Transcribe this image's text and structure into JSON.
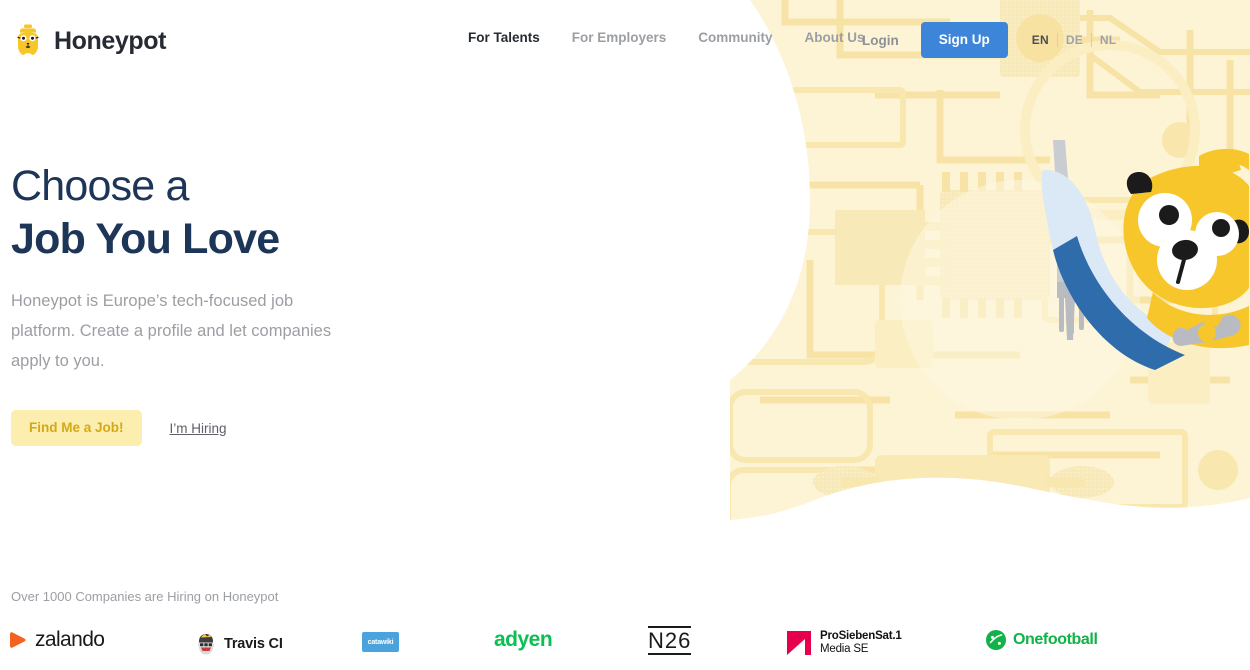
{
  "brand": {
    "name": "Honeypot",
    "logo_icon": "honeypot-bear-icon"
  },
  "nav": {
    "items": [
      {
        "label": "For Talents",
        "active": true
      },
      {
        "label": "For Employers",
        "active": false
      },
      {
        "label": "Community",
        "active": false
      },
      {
        "label": "About Us",
        "active": false
      }
    ],
    "login_label": "Login",
    "signup_label": "Sign Up",
    "languages": [
      {
        "code": "EN",
        "active": true
      },
      {
        "code": "DE",
        "active": false
      },
      {
        "code": "NL",
        "active": false
      }
    ]
  },
  "hero": {
    "headline_line1": "Choose a",
    "headline_line2": "Job You Love",
    "subcopy": "Honeypot is Europe’s tech-focused job platform. Create a profile and let companies apply to you.",
    "cta_primary": "Find Me a Job!",
    "cta_secondary": "I’m Hiring",
    "illustration_icon": "bear-mascot-with-wrench-illustration",
    "background_icon": "circuit-board-pattern"
  },
  "companies": {
    "label": "Over 1000 Companies are Hiring on Honeypot",
    "logos": [
      {
        "name": "zalando",
        "text": "zalando"
      },
      {
        "name": "travis-ci",
        "text": "Travis CI"
      },
      {
        "name": "catawiki",
        "text": "catawiki"
      },
      {
        "name": "adyen",
        "text": "adyen"
      },
      {
        "name": "n26",
        "text": "N26"
      },
      {
        "name": "prosiebensat1",
        "text_line1": "ProSiebenSat.1",
        "text_line2": "Media SE"
      },
      {
        "name": "onefootball",
        "text": "Onefootball"
      }
    ]
  },
  "colors": {
    "accent_blue": "#3d85d8",
    "accent_yellow": "#f6c62b",
    "cream_bg": "#fdf3d4",
    "headline_navy": "#1d3557",
    "muted_text": "#9b9ea3",
    "cta_yellow_bg": "#fbeeae",
    "cta_yellow_text": "#d5a817"
  }
}
